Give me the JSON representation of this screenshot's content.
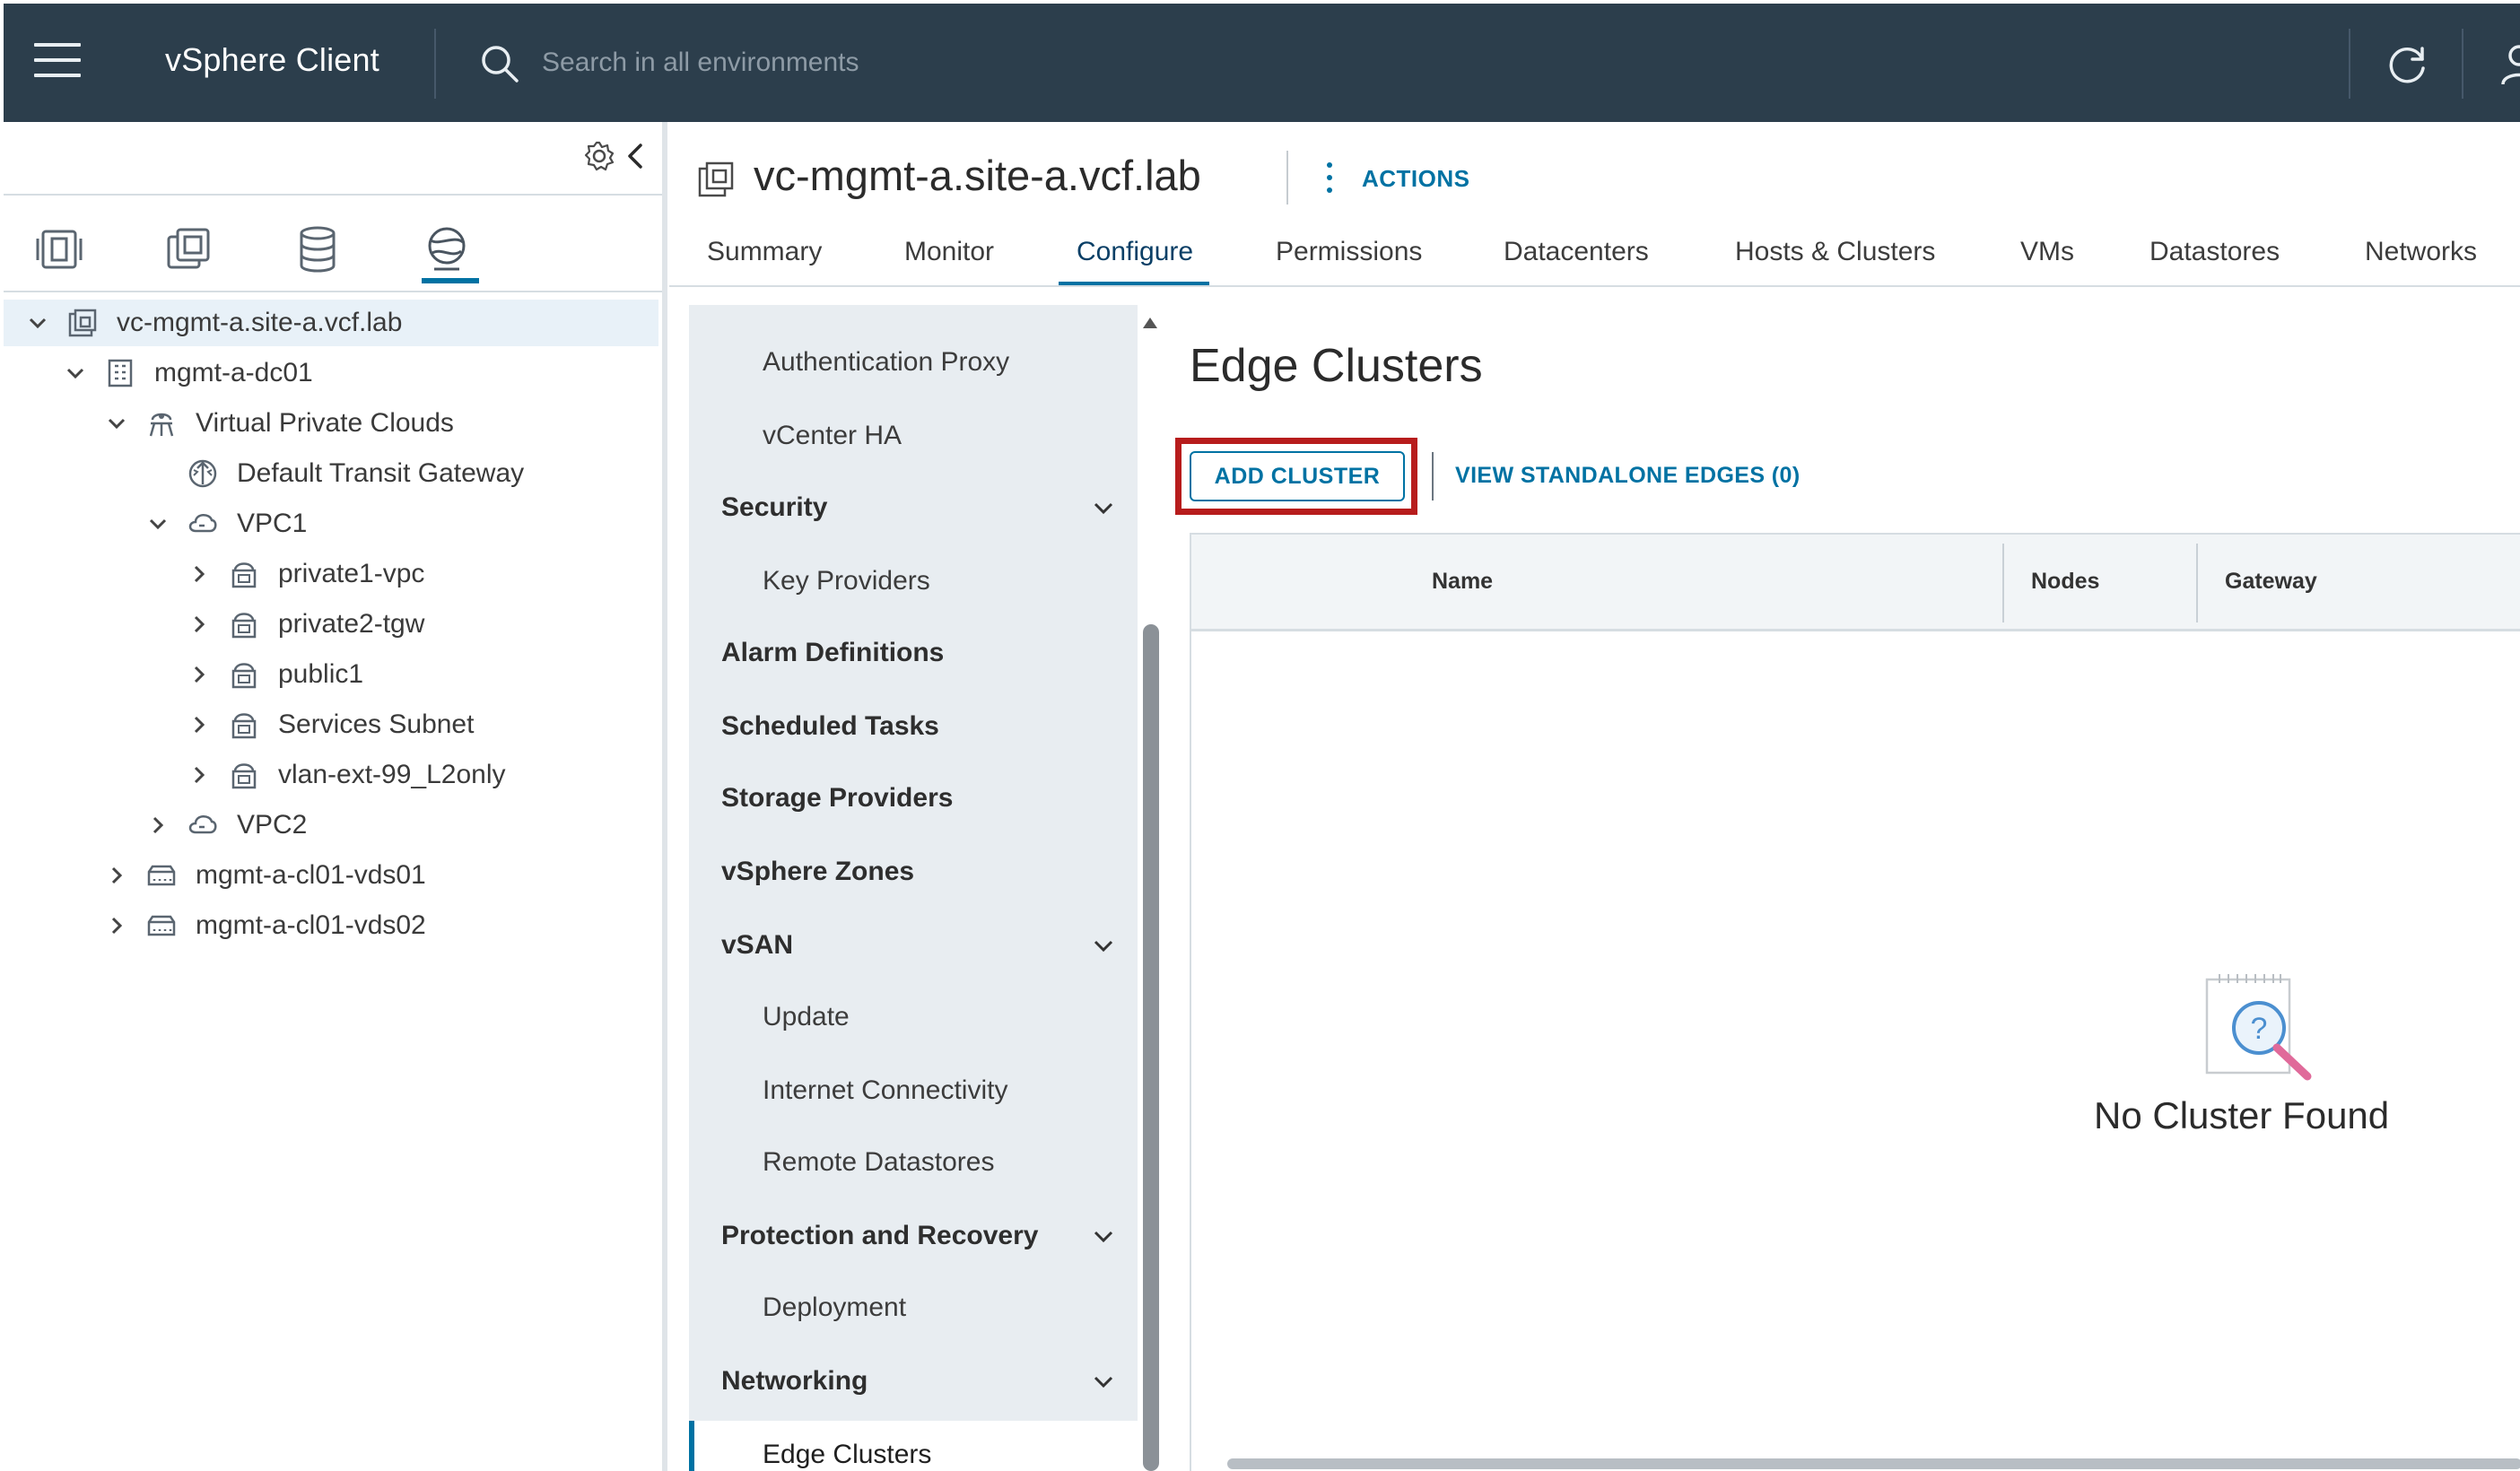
{
  "header": {
    "app_title": "vSphere Client",
    "search_placeholder": "Search in all environments",
    "icons": [
      "hamburger-menu-icon",
      "search-icon",
      "refresh-icon",
      "user-icon"
    ]
  },
  "navigator": {
    "tabs": [
      "hosts-clusters-icon",
      "vms-templates-icon",
      "storage-icon",
      "networking-icon"
    ],
    "active_tab": "networking-icon",
    "tree": [
      {
        "label": "vc-mgmt-a.site-a.vcf.lab",
        "icon": "vcenter-icon",
        "expanded": true,
        "selected": true
      },
      {
        "label": "mgmt-a-dc01",
        "icon": "datacenter-icon",
        "expanded": true
      },
      {
        "label": "Virtual Private Clouds",
        "icon": "vpc-group-icon",
        "expanded": true
      },
      {
        "label": "Default Transit Gateway",
        "icon": "transit-gateway-icon"
      },
      {
        "label": "VPC1",
        "icon": "vpc-icon",
        "expanded": true
      },
      {
        "label": "private1-vpc",
        "icon": "subnet-icon",
        "expanded": false
      },
      {
        "label": "private2-tgw",
        "icon": "subnet-icon",
        "expanded": false
      },
      {
        "label": "public1",
        "icon": "subnet-icon",
        "expanded": false
      },
      {
        "label": "Services Subnet",
        "icon": "subnet-icon",
        "expanded": false
      },
      {
        "label": "vlan-ext-99_L2only",
        "icon": "subnet-icon",
        "expanded": false
      },
      {
        "label": "VPC2",
        "icon": "vpc-icon",
        "expanded": false
      },
      {
        "label": "mgmt-a-cl01-vds01",
        "icon": "switch-icon",
        "expanded": false
      },
      {
        "label": "mgmt-a-cl01-vds02",
        "icon": "switch-icon",
        "expanded": false
      }
    ]
  },
  "object": {
    "title": "vc-mgmt-a.site-a.vcf.lab",
    "actions_label": "ACTIONS",
    "tabs": [
      "Summary",
      "Monitor",
      "Configure",
      "Permissions",
      "Datacenters",
      "Hosts & Clusters",
      "VMs",
      "Datastores",
      "Networks"
    ],
    "active_tab": "Configure"
  },
  "settings": {
    "items": [
      {
        "label": "Authentication Proxy",
        "kind": "sub"
      },
      {
        "label": "vCenter HA",
        "kind": "sub"
      },
      {
        "label": "Security",
        "kind": "group",
        "expanded": true
      },
      {
        "label": "Key Providers",
        "kind": "sub"
      },
      {
        "label": "Alarm Definitions",
        "kind": "group"
      },
      {
        "label": "Scheduled Tasks",
        "kind": "group"
      },
      {
        "label": "Storage Providers",
        "kind": "group"
      },
      {
        "label": "vSphere Zones",
        "kind": "group"
      },
      {
        "label": "vSAN",
        "kind": "group",
        "expanded": true
      },
      {
        "label": "Update",
        "kind": "sub"
      },
      {
        "label": "Internet Connectivity",
        "kind": "sub"
      },
      {
        "label": "Remote Datastores",
        "kind": "sub"
      },
      {
        "label": "Protection and Recovery",
        "kind": "group",
        "expanded": true
      },
      {
        "label": "Deployment",
        "kind": "sub"
      },
      {
        "label": "Networking",
        "kind": "group",
        "expanded": true
      },
      {
        "label": "Edge Clusters",
        "kind": "sub",
        "active": true
      }
    ]
  },
  "main": {
    "page_title": "Edge Clusters",
    "add_cluster_label": "ADD CLUSTER",
    "standalone_link": "VIEW STANDALONE EDGES (0)",
    "columns": [
      "Name",
      "Nodes",
      "Gateway"
    ],
    "empty_message": "No Cluster Found",
    "empty_icon": "search-document-icon"
  },
  "colors": {
    "header_bg": "#2c3e4c",
    "accent": "#0072a3",
    "highlight": "#b71c1c",
    "settings_bg": "#e8edf1"
  }
}
